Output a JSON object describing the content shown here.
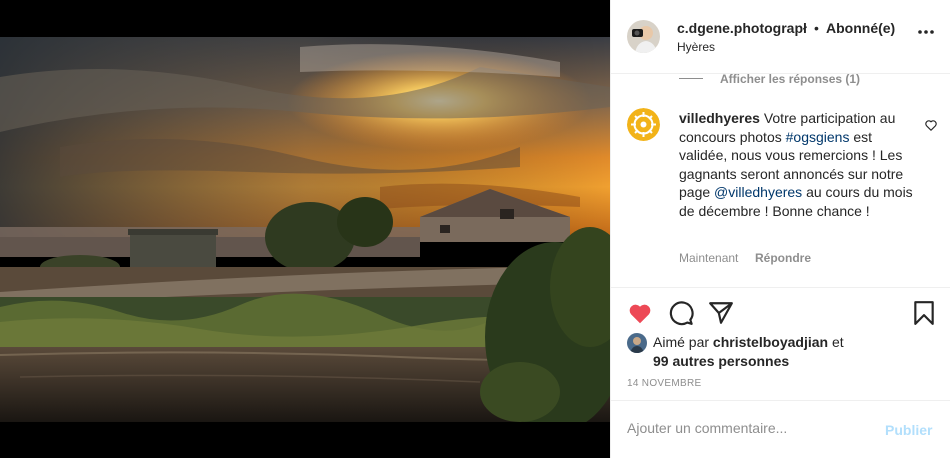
{
  "post": {
    "author": {
      "username": "c.dgene.photograpł",
      "follow_status": "Abonné(e)",
      "separator": "•",
      "location": "Hyères"
    },
    "more_icon": "more-horizontal-icon"
  },
  "comments": {
    "replies_toggle": "Afficher les réponses (1)",
    "items": [
      {
        "username": "villedhyeres",
        "text_1": "Votre participation au concours photos ",
        "hashtag": "#ogsgiens",
        "text_2": " est validée, nous vous remercions ! Les gagnants seront annoncés sur notre page ",
        "mention": "@villedhyeres",
        "text_3": " au cours du mois de décembre ! Bonne chance !",
        "time": "Maintenant",
        "reply_label": "Répondre",
        "like_icon": "heart-outline-icon"
      }
    ]
  },
  "actions": {
    "like_icon": "heart-filled-icon",
    "comment_icon": "comment-icon",
    "share_icon": "paper-plane-icon",
    "save_icon": "bookmark-icon",
    "liked_prefix": "Aimé par ",
    "liked_user": "christelboyadjian",
    "liked_conj": " et",
    "liked_others": "99 autres personnes",
    "date": "14 NOVEMBRE",
    "like_color": "#ed4956"
  },
  "composer": {
    "placeholder": "Ajouter un commentaire...",
    "publish_label": "Publier",
    "publish_color": "#b2dffc"
  }
}
